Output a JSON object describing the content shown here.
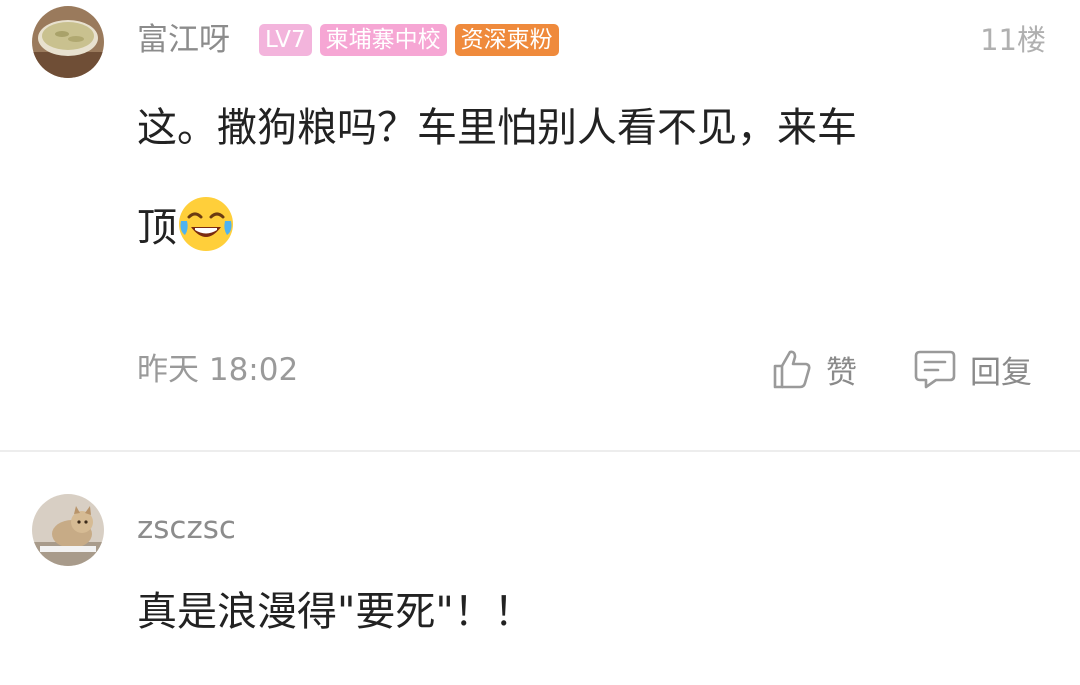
{
  "comment1": {
    "username": "富江呀",
    "badges": {
      "level": "LV7",
      "school": "柬埔寨中校",
      "fan": "资深柬粉"
    },
    "floor": "11楼",
    "content_line1": "这。撒狗粮吗？车里怕别人看不见，来车",
    "content_line2": "顶",
    "emoji": "laughing-tears-emoji",
    "time": "昨天 18:02",
    "like_label": "赞",
    "reply_label": "回复",
    "colors": {
      "badge_level": "#f3b4dc",
      "badge_school": "#f6a6d4",
      "badge_fan": "#ef8a3c"
    }
  },
  "comment2": {
    "username": "zsczsc",
    "content": "真是浪漫得\"要死\"！！"
  }
}
